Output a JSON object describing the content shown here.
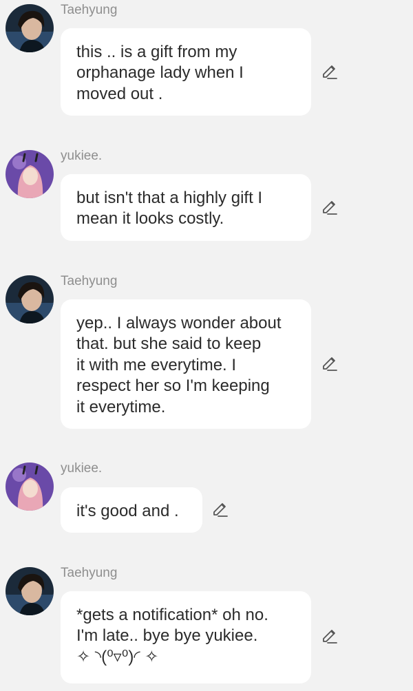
{
  "messages": [
    {
      "sender": "Taehyung",
      "text": "this .. is a gift from my\norphanage lady when I\nmoved out ."
    },
    {
      "sender": "yukiee.",
      "text": "but isn't that a highly gift I\nmean it looks costly."
    },
    {
      "sender": "Taehyung",
      "text": "yep.. I always wonder about\nthat.  but she said to keep\nit with me everytime.  I\nrespect her so I'm keeping\nit everytime."
    },
    {
      "sender": "yukiee.",
      "text": "it's good and ."
    },
    {
      "sender": "Taehyung",
      "text": "*gets a notification* oh no.\nI'm late.. bye bye yukiee.\n✧ ◝(⁰▿⁰)◜ ✧"
    }
  ],
  "icons": {
    "edit": "pencil-icon"
  }
}
